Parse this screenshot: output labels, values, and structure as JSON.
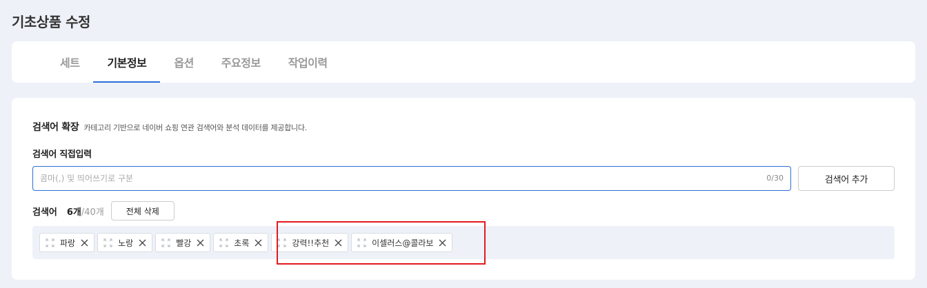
{
  "page": {
    "title": "기초상품 수정"
  },
  "tabs": [
    {
      "label": "세트",
      "active": false
    },
    {
      "label": "기본정보",
      "active": true
    },
    {
      "label": "옵션",
      "active": false
    },
    {
      "label": "주요정보",
      "active": false
    },
    {
      "label": "작업이력",
      "active": false
    }
  ],
  "search_expand": {
    "title": "검색어 확장",
    "description": "카테고리 기반으로 네이버 쇼핑 연관 검색어와 분석 데이터를 제공합니다."
  },
  "direct_input": {
    "label": "검색어 직접입력",
    "placeholder": "콤마(,) 및 띄어쓰기로 구분",
    "value": "",
    "counter": "0/30",
    "add_button": "검색어 추가"
  },
  "keywords": {
    "label": "검색어",
    "count": "6개",
    "max": "/40개",
    "delete_all": "전체 삭제",
    "items": [
      "파랑",
      "노랑",
      "빨강",
      "초록",
      "강력!!추천",
      "이셀러스@콜라보"
    ]
  },
  "colors": {
    "accent": "#2b6fd6",
    "highlight": "#e0191e"
  }
}
